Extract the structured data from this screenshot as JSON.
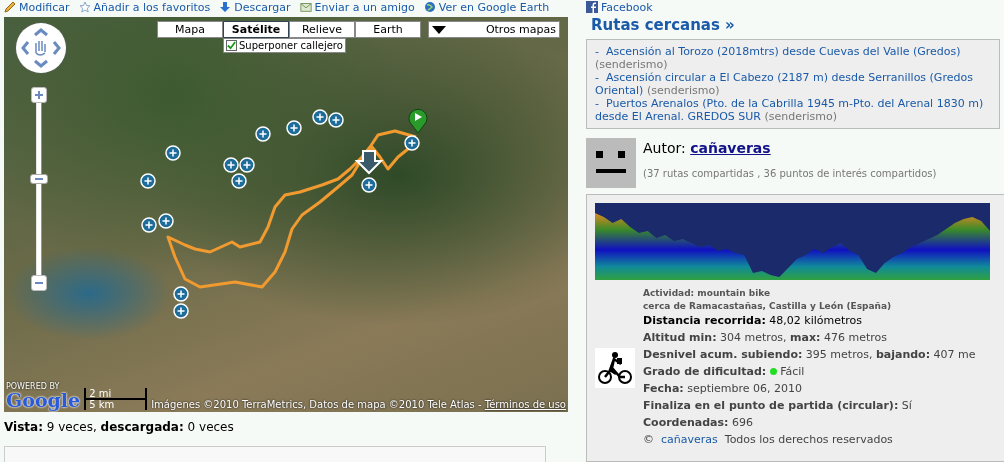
{
  "toolbar": [
    {
      "kind": "pencil",
      "label": "Modificar"
    },
    {
      "kind": "star",
      "label": "Añadir a los favoritos"
    },
    {
      "kind": "download",
      "label": "Descargar"
    },
    {
      "kind": "mail",
      "label": "Enviar a un amigo"
    },
    {
      "kind": "earth",
      "label": "Ver en Google Earth"
    },
    {
      "kind": "facebook",
      "label": "Facebook"
    }
  ],
  "map": {
    "type_buttons": [
      {
        "label": "Mapa",
        "selected": false
      },
      {
        "label": "Satélite",
        "selected": true
      },
      {
        "label": "Relieve",
        "selected": false
      },
      {
        "label": "Earth",
        "selected": false
      }
    ],
    "overlay": {
      "label": "Superponer callejero",
      "checked": true
    },
    "other_maps": "Otros mapas",
    "zoom": {
      "level": 0.57
    },
    "powered": "POWERED BY",
    "logo": "Google",
    "scale": {
      "miles": "2 mi",
      "km": "5 km"
    },
    "attribution": "Imágenes ©2010 TerraMetrics, Datos de mapa ©2010 Tele Atlas -",
    "terms": "Términos de uso"
  },
  "stats": "**Vista:** 9 veces, **descargada:** 0 veces",
  "nearby": {
    "title": "Rutas cercanas »",
    "routes": [
      {
        "marker": "-",
        "title": "Ascensión al Torozo (2018mtrs) desde Cuevas del Valle (Gredos)",
        "activity": "(senderismo)"
      },
      {
        "marker": "-",
        "title": "Ascensión circular a El Cabezo (2187 m) desde Serranillos (Gredos Oriental)",
        "activity": "(senderismo)"
      },
      {
        "marker": "-",
        "title": "Puertos Arenalos (Pto. de la Cabrilla 1945 m-Pto. del Arenal 1830 m) desde El Arenal. GREDOS SUR",
        "activity": "(senderismo)"
      }
    ]
  },
  "author": {
    "label": "Autor:",
    "name": "cañaveras",
    "summary": "(37 rutas compartidas , 36 puntos de interés compartidos)"
  },
  "details": {
    "activity": "Actividad: mountain bike",
    "near": "cerca de  Ramacastañas, Castilla y León (España)",
    "rows": [
      {
        "kind": "primary",
        "text": "**Distancia recorrida:** 48,02 kilómetros"
      },
      {
        "kind": "text",
        "text": "**Altitud min:** 304 metros, **max:** 476 metros"
      },
      {
        "kind": "text",
        "text": "**Desnivel acum. subiendo:** 395 metros, **bajando:** 407 me"
      },
      {
        "kind": "difficulty",
        "label": "Grado de dificultad:",
        "value": "Fácil",
        "color": "#22dd22"
      },
      {
        "kind": "text",
        "text": "**Fecha:**  septiembre 06, 2010"
      },
      {
        "kind": "text",
        "text": "**Finaliza en el punto de partida (circular):**   Sí"
      },
      {
        "kind": "text",
        "text": "**Coordenadas:** 696"
      }
    ],
    "copyright": {
      "symbol": "©",
      "author": "cañaveras",
      "text": "Todos los derechos reservados"
    }
  }
}
